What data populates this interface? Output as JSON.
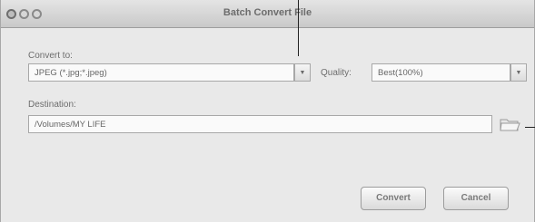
{
  "window": {
    "title": "Batch Convert File"
  },
  "convert": {
    "label": "Convert to:",
    "value": "JPEG (*.jpg;*.jpeg)"
  },
  "quality": {
    "label": "Quality:",
    "value": "Best(100%)"
  },
  "destination": {
    "label": "Destination:",
    "value": "/Volumes/MY LIFE"
  },
  "buttons": {
    "convert": "Convert",
    "cancel": "Cancel"
  }
}
